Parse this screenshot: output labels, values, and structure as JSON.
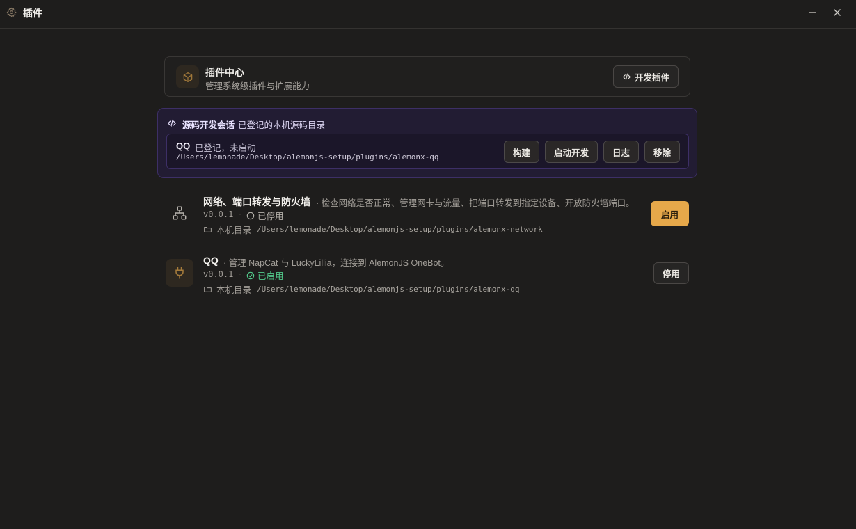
{
  "window": {
    "title": "插件",
    "icons": {
      "app": "gear-icon",
      "minimize": "minimize-icon",
      "close": "close-icon"
    }
  },
  "hub": {
    "title": "插件中心",
    "subtitle": "管理系统级插件与扩展能力",
    "dev_button_label": "开发插件",
    "icon": "package-icon"
  },
  "dev_session": {
    "title": "源码开发会话",
    "description": "已登记的本机源码目录",
    "plugin_name": "QQ",
    "status": "已登记，未启动",
    "path": "/Users/lemonade/Desktop/alemonjs-setup/plugins/alemonx-qq",
    "buttons": {
      "build": "构建",
      "start_dev": "启动开发",
      "logs": "日志",
      "remove": "移除"
    }
  },
  "plugins": [
    {
      "name": "网络、端口转发与防火墙",
      "description": "· 检查网络是否正常、管理网卡与流量、把端口转发到指定设备、开放防火墙端口。",
      "version": "v0.0.1",
      "state": "已停用",
      "dir_label": "本机目录",
      "path": "/Users/lemonade/Desktop/alemonjs-setup/plugins/alemonx-network",
      "action_label": "启用",
      "icon": "network-icon"
    },
    {
      "name": "QQ",
      "description": "· 管理 NapCat 与 LuckyLillia，连接到 AlemonJS OneBot。",
      "version": "v0.0.1",
      "state": "已启用",
      "dir_label": "本机目录",
      "path": "/Users/lemonade/Desktop/alemonjs-setup/plugins/alemonx-qq",
      "action_label": "停用",
      "icon": "plug-icon"
    }
  ],
  "separator": "·",
  "colors": {
    "accent": "#e6a84a",
    "enabled": "#52c98a",
    "session_border": "#3d2f66"
  }
}
